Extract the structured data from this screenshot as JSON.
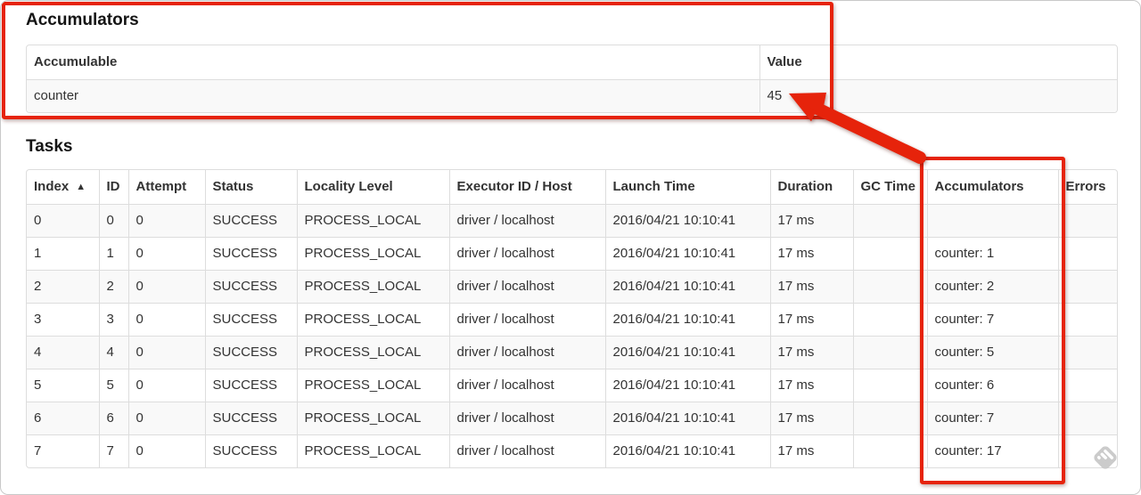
{
  "page": {
    "background": "#ffffff",
    "annotation_color": "#e6230b",
    "table_border_color": "#dddddd",
    "row_stripe_color": "#f9f9f9"
  },
  "accumulators_section": {
    "title": "Accumulators",
    "table": {
      "headers": [
        "Accumulable",
        "Value"
      ],
      "rows": [
        {
          "accumulable": "counter",
          "value": "45"
        }
      ]
    }
  },
  "tasks_section": {
    "title": "Tasks",
    "table": {
      "headers": [
        "Index",
        "ID",
        "Attempt",
        "Status",
        "Locality Level",
        "Executor ID / Host",
        "Launch Time",
        "Duration",
        "GC Time",
        "Accumulators",
        "Errors"
      ],
      "sorted_column": "Index",
      "sort_indicator": "▲",
      "rows": [
        {
          "cells": [
            "0",
            "0",
            "0",
            "SUCCESS",
            "PROCESS_LOCAL",
            "driver / localhost",
            "2016/04/21 10:10:41",
            "17 ms",
            "",
            "",
            ""
          ]
        },
        {
          "cells": [
            "1",
            "1",
            "0",
            "SUCCESS",
            "PROCESS_LOCAL",
            "driver / localhost",
            "2016/04/21 10:10:41",
            "17 ms",
            "",
            "counter: 1",
            ""
          ]
        },
        {
          "cells": [
            "2",
            "2",
            "0",
            "SUCCESS",
            "PROCESS_LOCAL",
            "driver / localhost",
            "2016/04/21 10:10:41",
            "17 ms",
            "",
            "counter: 2",
            ""
          ]
        },
        {
          "cells": [
            "3",
            "3",
            "0",
            "SUCCESS",
            "PROCESS_LOCAL",
            "driver / localhost",
            "2016/04/21 10:10:41",
            "17 ms",
            "",
            "counter: 7",
            ""
          ]
        },
        {
          "cells": [
            "4",
            "4",
            "0",
            "SUCCESS",
            "PROCESS_LOCAL",
            "driver / localhost",
            "2016/04/21 10:10:41",
            "17 ms",
            "",
            "counter: 5",
            ""
          ]
        },
        {
          "cells": [
            "5",
            "5",
            "0",
            "SUCCESS",
            "PROCESS_LOCAL",
            "driver / localhost",
            "2016/04/21 10:10:41",
            "17 ms",
            "",
            "counter: 6",
            ""
          ]
        },
        {
          "cells": [
            "6",
            "6",
            "0",
            "SUCCESS",
            "PROCESS_LOCAL",
            "driver / localhost",
            "2016/04/21 10:10:41",
            "17 ms",
            "",
            "counter: 7",
            ""
          ]
        },
        {
          "cells": [
            "7",
            "7",
            "0",
            "SUCCESS",
            "PROCESS_LOCAL",
            "driver / localhost",
            "2016/04/21 10:10:41",
            "17 ms",
            "",
            "counter: 17",
            ""
          ]
        }
      ]
    }
  }
}
